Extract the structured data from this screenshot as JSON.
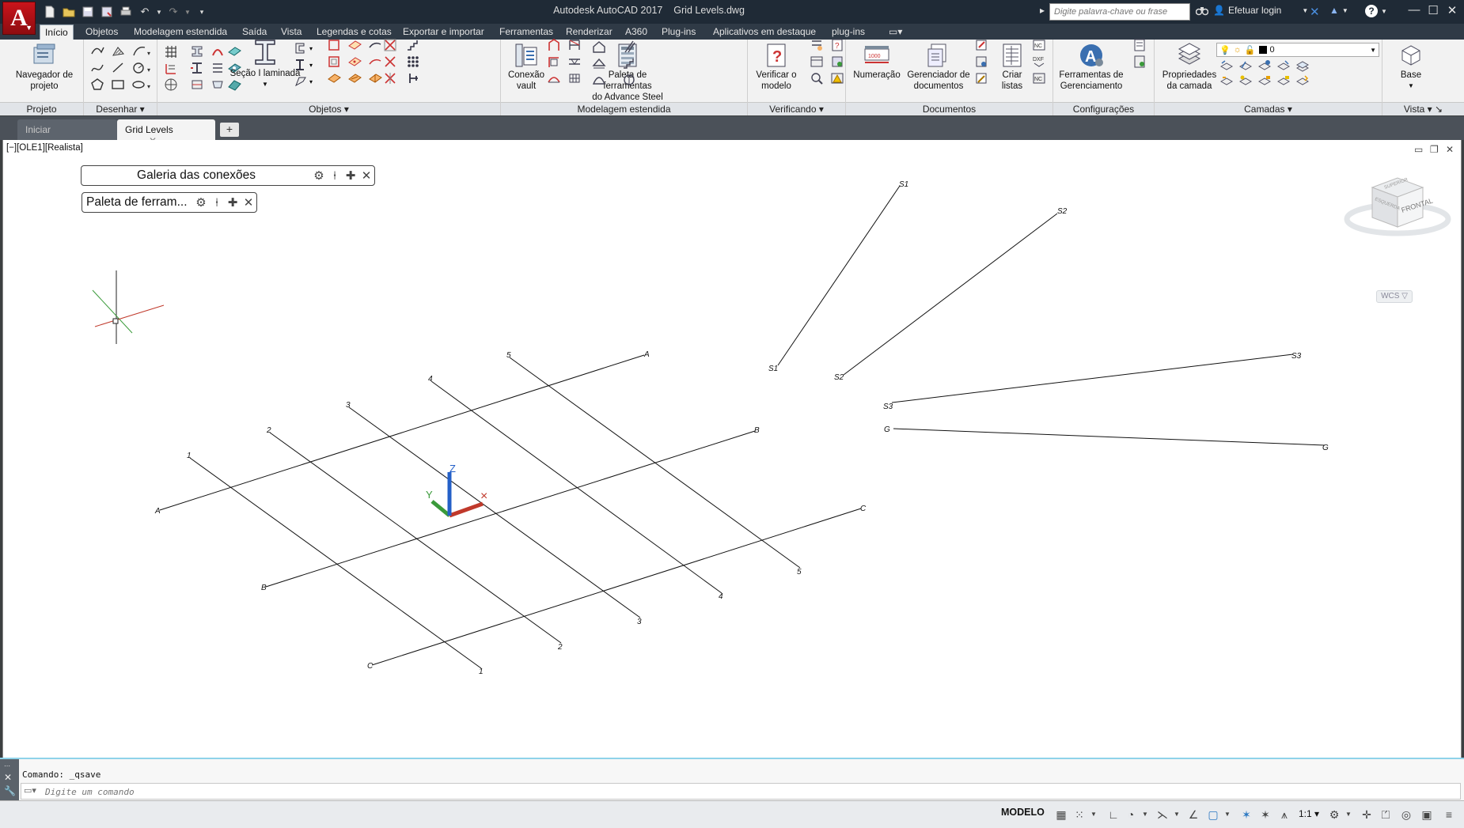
{
  "titlebar": {
    "app_name": "Autodesk AutoCAD 2017",
    "file_name": "Grid Levels.dwg",
    "search_placeholder": "Digite palavra-chave ou frase",
    "login_label": "Efetuar login",
    "app_button_letter": "A"
  },
  "ribbon_tabs": [
    {
      "label": "Início"
    },
    {
      "label": "Objetos"
    },
    {
      "label": "Modelagem estendida"
    },
    {
      "label": "Saída"
    },
    {
      "label": "Vista"
    },
    {
      "label": "Legendas e cotas"
    },
    {
      "label": "Exportar e importar"
    },
    {
      "label": "Ferramentas"
    },
    {
      "label": "Renderizar"
    },
    {
      "label": "A360"
    },
    {
      "label": "Plug-ins"
    },
    {
      "label": "Aplicativos em destaque"
    },
    {
      "label": "plug-ins"
    }
  ],
  "ribbon": {
    "panels": {
      "projeto": "Projeto",
      "desenhar": "Desenhar ▾",
      "objetos": "Objetos ▾",
      "modelagem": "Modelagem estendida",
      "verificando": "Verificando ▾",
      "documentos": "Documentos",
      "configuracoes": "Configurações",
      "camadas": "Camadas ▾",
      "vista": "Vista ▾ ↘"
    },
    "buttons": {
      "navegador_l1": "Navegador de",
      "navegador_l2": "projeto",
      "secao": "Seção I laminada",
      "conexao_l1": "Conexão",
      "conexao_l2": "vault",
      "paleta_l1": "Paleta de ferramentas",
      "paleta_l2": "do Advance Steel",
      "verificar_l1": "Verificar o",
      "verificar_l2": "modelo",
      "numeracao": "Numeração",
      "numeracao_badge": "1000",
      "gerenciador_l1": "Gerenciador de",
      "gerenciador_l2": "documentos",
      "criar_l1": "Criar",
      "criar_l2": "listas",
      "ferramentas_l1": "Ferramentas de",
      "ferramentas_l2": "Gerenciamento",
      "propriedades_l1": "Propriedades",
      "propriedades_l2": "da camada",
      "base": "Base"
    },
    "layer_value": "0"
  },
  "doc_tabs": [
    {
      "label": "Iniciar"
    },
    {
      "label": "Grid Levels"
    }
  ],
  "viewport": {
    "label": "[−][OLE1][Realista]",
    "palette1_title": "Galeria das conexões",
    "palette2_title": "Paleta de ferram...",
    "wcs": "WCS ▽",
    "viewcube_front": "FRONTAL",
    "viewcube_left": "ESQUERDA",
    "viewcube_top": "SUPERIOR"
  },
  "grid_labels": {
    "a": "A",
    "b": "B",
    "c": "C",
    "n1": "1",
    "n2": "2",
    "n3": "3",
    "n4": "4",
    "n5": "5",
    "s1": "S1",
    "s2": "S2",
    "s3": "S3",
    "s4": "G"
  },
  "command": {
    "history": "Comando: _qsave",
    "placeholder": "Digite um comando"
  },
  "statusbar": {
    "model": "MODELO",
    "scale": "1:1 ▾"
  },
  "colors": {
    "title_bg": "#1f2a36",
    "ribbon_bg": "#f2f2f2",
    "accent_red": "#c9141b",
    "axis_x": "#c0392b",
    "axis_y": "#3a9a3a",
    "axis_z": "#2460c8"
  }
}
